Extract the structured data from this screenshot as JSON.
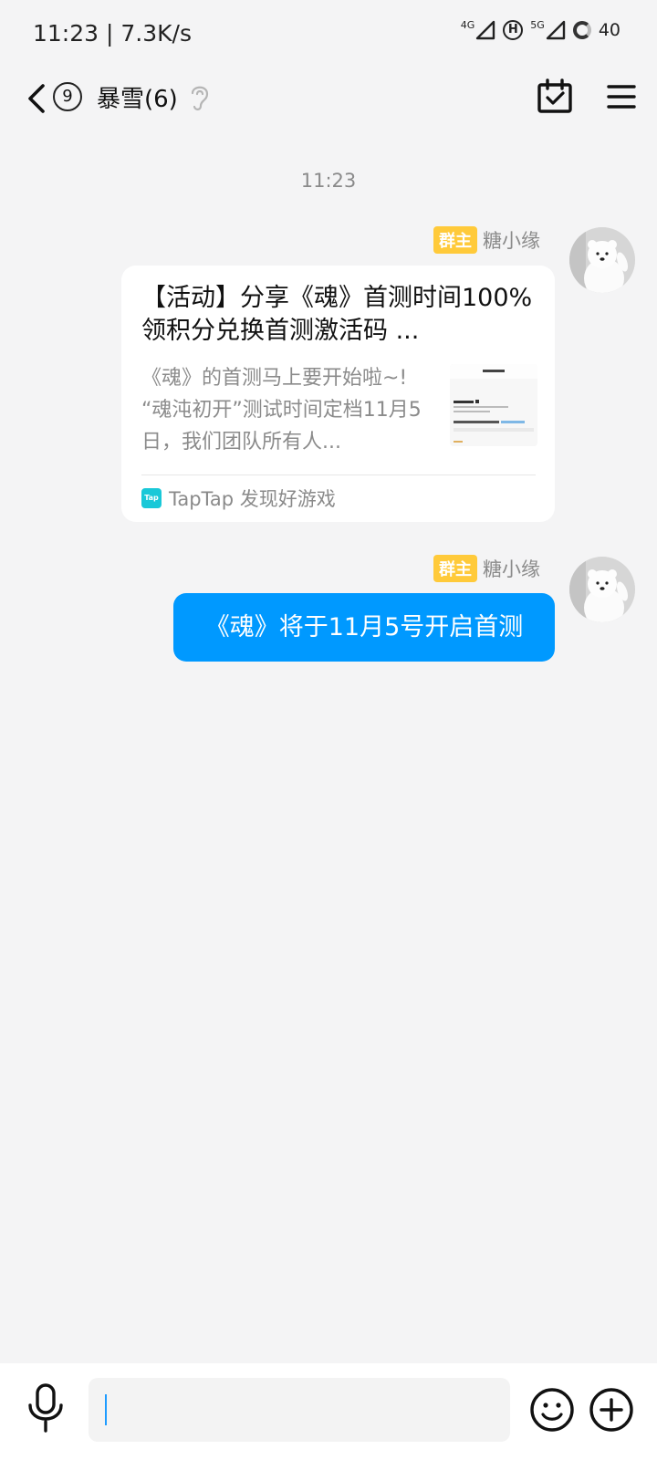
{
  "status_bar": {
    "time": "11:23",
    "speed": "7.3K/s",
    "net1": "4G",
    "hd": "H",
    "net2": "5G",
    "battery": "40"
  },
  "header": {
    "unread_count": "9",
    "title": "暴雪(6)",
    "icons": [
      "back-arrow-icon",
      "ear-icon",
      "calendar-check-icon",
      "menu-icon"
    ]
  },
  "chat": {
    "timestamp": "11:23",
    "messages": [
      {
        "badge": "群主",
        "sender": "糖小缘",
        "type": "link_card",
        "title": "【活动】分享《魂》首测时间100%领积分兑换首测激活码 ...",
        "description": "《魂》的首测马上要开始啦~! “魂沌初开”测试时间定档11月5日，我们团队所有人...",
        "source_logo": "Tap",
        "source": "TapTap 发现好游戏"
      },
      {
        "badge": "群主",
        "sender": "糖小缘",
        "type": "text",
        "text": "《魂》将于11月5号开启首测"
      }
    ]
  },
  "colors": {
    "accent": "#0099ff",
    "badge": "#ffca3a",
    "background": "#f4f4f5"
  }
}
